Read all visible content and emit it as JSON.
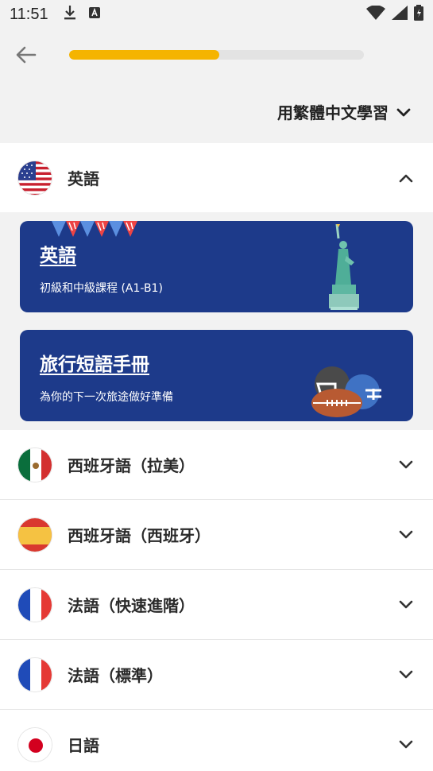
{
  "status": {
    "time": "11:51"
  },
  "progress": {
    "fraction": 0.51
  },
  "language_selector": {
    "label": "用繁體中文學習"
  },
  "courses": [
    {
      "name": "英語",
      "expanded": true,
      "cards": [
        {
          "title": "英語",
          "subtitle": "初級和中級課程 (A1-B1)"
        },
        {
          "title": "旅行短語手冊",
          "subtitle": "為你的下一次旅途做好準備"
        }
      ]
    },
    {
      "name": "西班牙語（拉美）"
    },
    {
      "name": "西班牙語（西班牙）"
    },
    {
      "name": "法語（快速進階）"
    },
    {
      "name": "法語（標準）"
    },
    {
      "name": "日語"
    }
  ],
  "colors": {
    "accent": "#f5b400",
    "card": "#1d3a8a"
  }
}
